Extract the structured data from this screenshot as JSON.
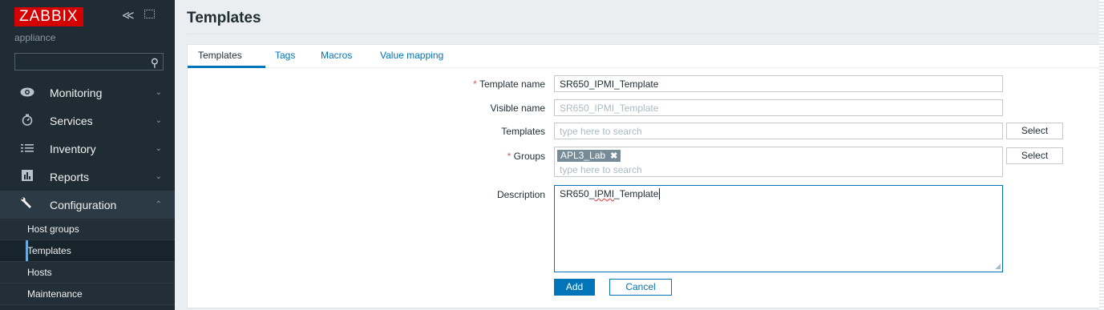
{
  "sidebar": {
    "logo": "ZABBIX",
    "collapse_glyph": "≪",
    "subtitle": "appliance",
    "search_value": "",
    "menu": [
      {
        "label": "Monitoring",
        "icon": "eye-icon"
      },
      {
        "label": "Services",
        "icon": "stopwatch-icon"
      },
      {
        "label": "Inventory",
        "icon": "list-icon"
      },
      {
        "label": "Reports",
        "icon": "bar-chart-icon"
      },
      {
        "label": "Configuration",
        "icon": "wrench-icon"
      }
    ],
    "submenu": [
      {
        "label": "Host groups"
      },
      {
        "label": "Templates"
      },
      {
        "label": "Hosts"
      },
      {
        "label": "Maintenance"
      }
    ]
  },
  "page": {
    "title": "Templates"
  },
  "tabs": [
    "Templates",
    "Tags",
    "Macros",
    "Value mapping"
  ],
  "form": {
    "required_mark": "*",
    "template_name_label": "Template name",
    "template_name_value": "SR650_IPMI_Template",
    "visible_name_label": "Visible name",
    "visible_name_placeholder": "SR650_IPMI_Template",
    "templates_label": "Templates",
    "templates_placeholder": "type here to search",
    "templates_select": "Select",
    "groups_label": "Groups",
    "groups_chip": "APL3_Lab",
    "groups_placeholder": "type here to search",
    "groups_select": "Select",
    "description_label": "Description",
    "description_part1": "SR650_",
    "description_part2": "IPMI",
    "description_part3": "_Template",
    "add_label": "Add",
    "cancel_label": "Cancel"
  },
  "colors": {
    "sidebar_bg": "#1f2c33",
    "accent": "#0275b8",
    "logo_red": "#d40000",
    "required": "#e45959"
  }
}
